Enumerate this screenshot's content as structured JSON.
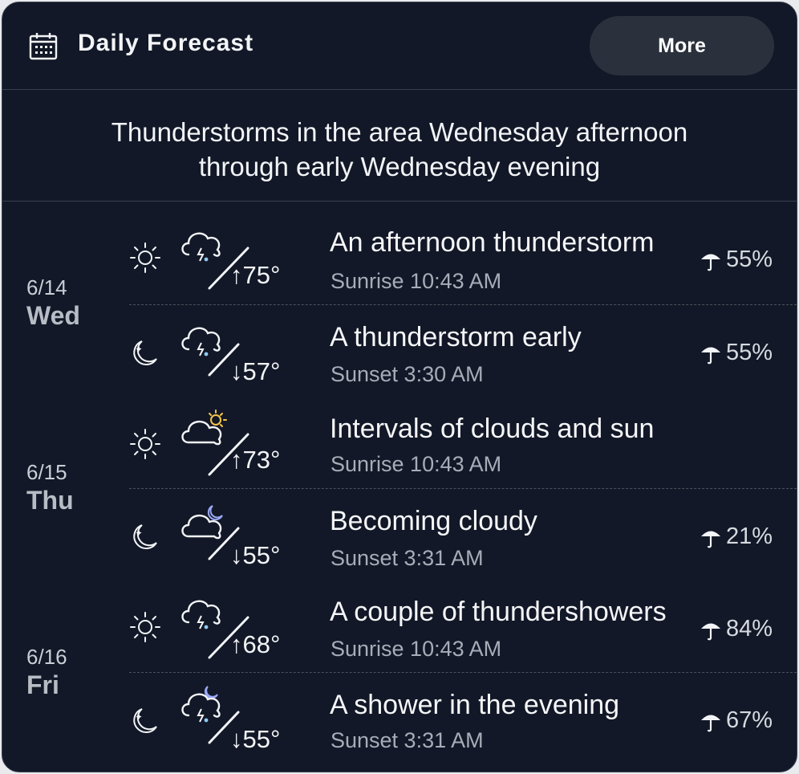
{
  "header": {
    "title": "Daily Forecast",
    "more_label": "More"
  },
  "summary": {
    "line1": "Thunderstorms in the area Wednesday afternoon",
    "line2": "through early Wednesday evening"
  },
  "days": [
    {
      "date": "6/14",
      "name": "Wed"
    },
    {
      "date": "6/15",
      "name": "Thu"
    },
    {
      "date": "6/16",
      "name": "Fri"
    }
  ],
  "rows": [
    {
      "period": "day",
      "icon": "thunderstorm-icon",
      "arrow": "↑",
      "temp": "75°",
      "desc": "An afternoon thunderstorm",
      "sub": "Sunrise 10:43 AM",
      "precip": "55%"
    },
    {
      "period": "night",
      "icon": "thunderstorm-icon",
      "arrow": "↓",
      "temp": "57°",
      "desc": "A thunderstorm early",
      "sub": "Sunset 3:30 AM",
      "precip": "55%"
    },
    {
      "period": "day",
      "icon": "partly-sunny-icon",
      "arrow": "↑",
      "temp": "73°",
      "desc": "Intervals of clouds and sun",
      "sub": "Sunrise 10:43 AM",
      "precip": ""
    },
    {
      "period": "night",
      "icon": "partly-cloudy-night-icon",
      "arrow": "↓",
      "temp": "55°",
      "desc": "Becoming cloudy",
      "sub": "Sunset 3:31 AM",
      "precip": "21%"
    },
    {
      "period": "day",
      "icon": "thunderstorm-icon",
      "arrow": "↑",
      "temp": "68°",
      "desc": "A couple of thundershowers",
      "sub": "Sunrise 10:43 AM",
      "precip": "84%"
    },
    {
      "period": "night",
      "icon": "night-shower-icon",
      "arrow": "↓",
      "temp": "55°",
      "desc": "A shower in the evening",
      "sub": "Sunset 3:31 AM",
      "precip": "67%"
    }
  ],
  "colors": {
    "background": "#121827",
    "button": "#2b313c",
    "divider": "#3a404c",
    "sun_accent": "#f5c54a",
    "moon_accent": "#9aa8f5"
  }
}
